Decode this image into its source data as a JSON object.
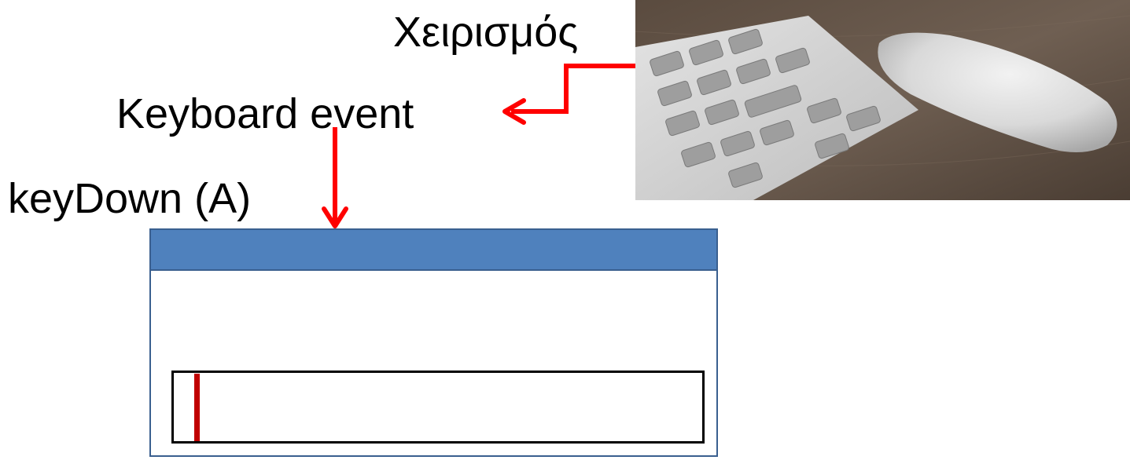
{
  "labels": {
    "handling": "Χειρισμός",
    "keyboard_event": "Keyboard event",
    "keydown": "keyDown (A)"
  },
  "colors": {
    "arrow": "#ff0000",
    "titlebar": "#4f81bd",
    "window_border": "#3a5f8f",
    "caret": "#c00000"
  },
  "icons": {
    "photo": "keyboard-and-mouse-photo"
  }
}
